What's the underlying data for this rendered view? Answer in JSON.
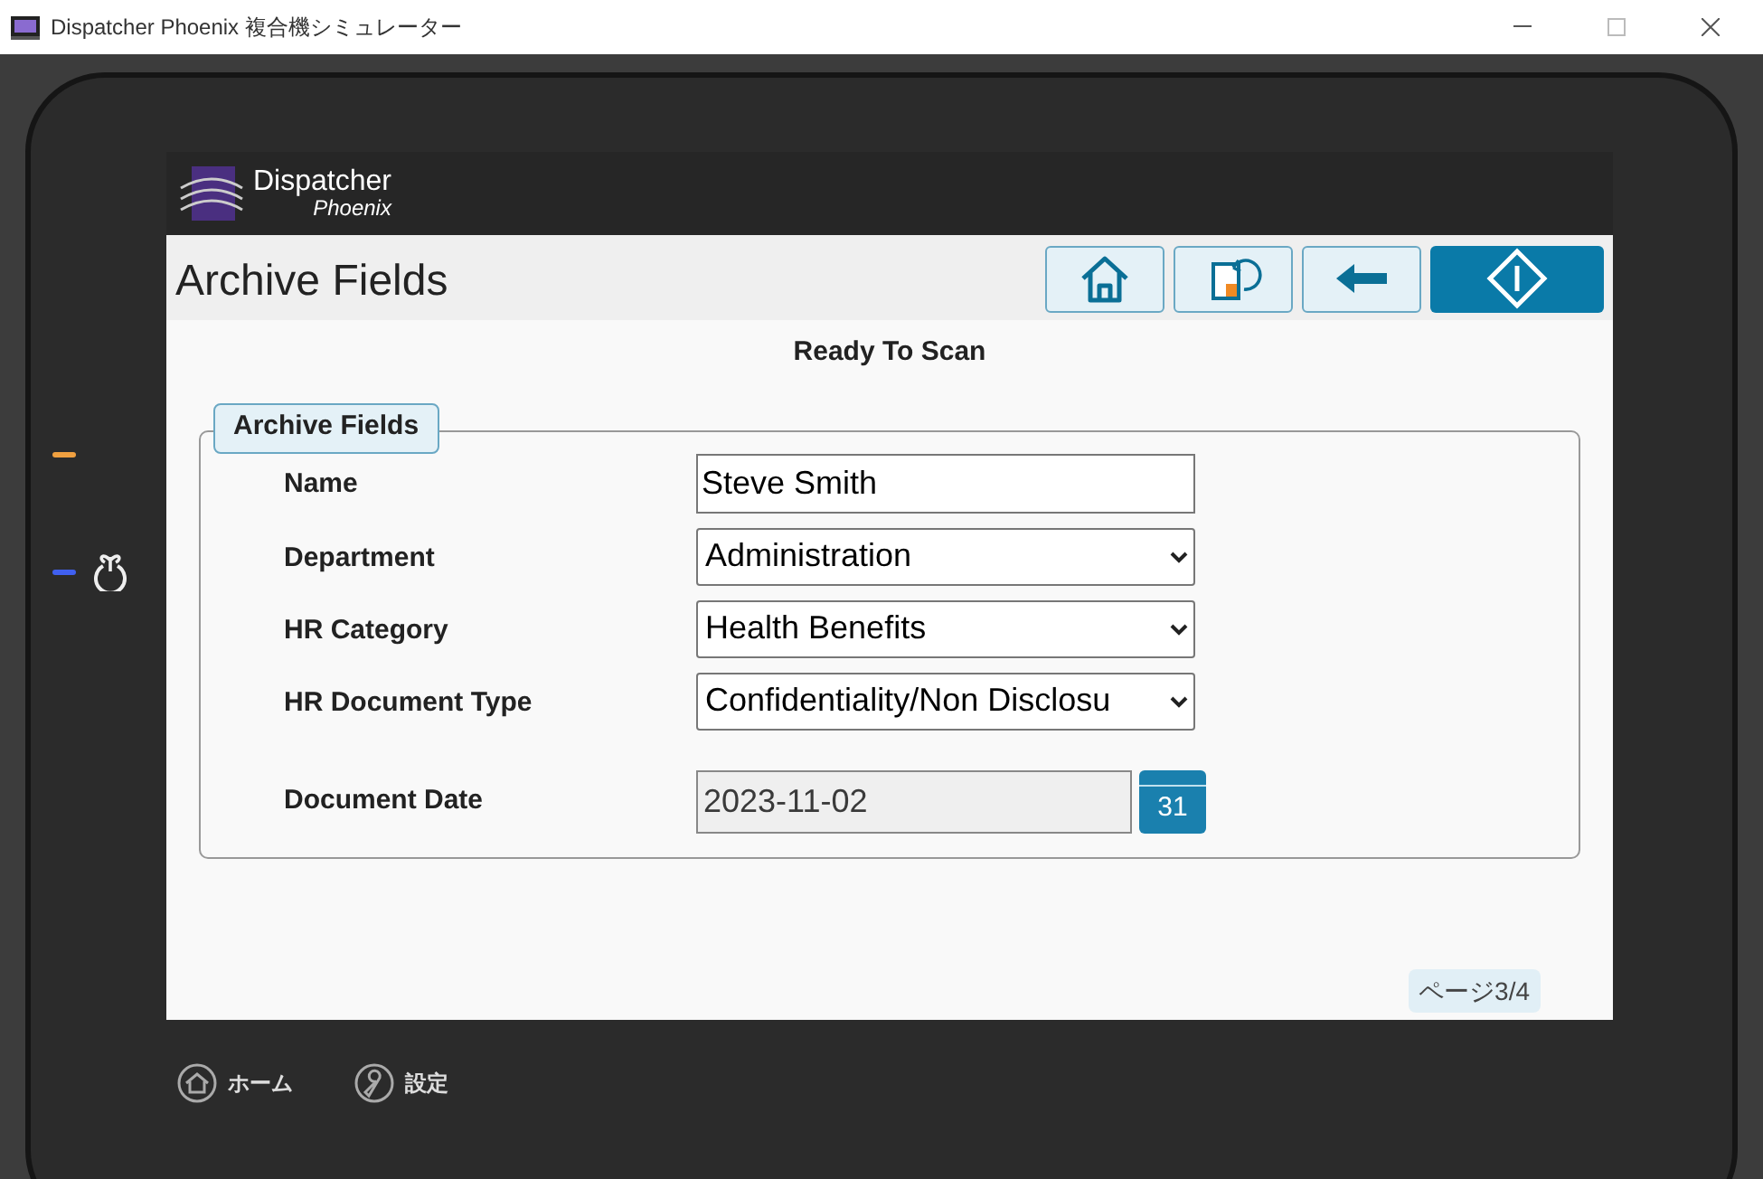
{
  "window": {
    "title": "Dispatcher Phoenix 複合機シミュレーター"
  },
  "logo": {
    "line_1": "Dispatcher",
    "line_2": "Phoenix"
  },
  "page_title": "Archive Fields",
  "toolbar": [
    {
      "kind": "home"
    },
    {
      "kind": "workflow"
    },
    {
      "kind": "back"
    },
    {
      "kind": "start"
    }
  ],
  "status": "Ready To Scan",
  "fieldset": {
    "legend": "Archive Fields",
    "fields": [
      {
        "kind": "text",
        "label": "Name",
        "value": "Steve Smith"
      },
      {
        "kind": "select",
        "label": "Department",
        "value": "Administration"
      },
      {
        "kind": "select",
        "label": "HR Category",
        "value": "Health Benefits"
      },
      {
        "kind": "select",
        "label": "HR Document Type",
        "value": "Confidentiality/Non Disclosu"
      },
      {
        "kind": "date",
        "label": "Document Date",
        "value": "2023-11-02",
        "calendar_day": "31",
        "disabled": true
      }
    ]
  },
  "page_indicator": "ページ3/4",
  "hardware_buttons": [
    {
      "kind": "home",
      "label": "ホーム"
    },
    {
      "kind": "settings",
      "label": "設定"
    }
  ]
}
